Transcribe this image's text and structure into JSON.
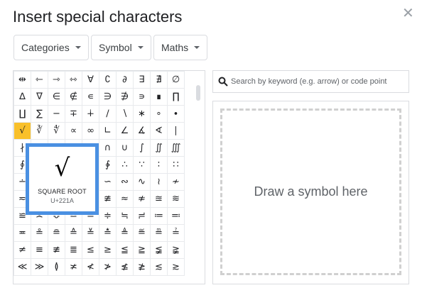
{
  "dialog": {
    "title": "Insert special characters",
    "close_icon": "close-icon"
  },
  "dropdowns": [
    {
      "label": "Categories"
    },
    {
      "label": "Symbol"
    },
    {
      "label": "Maths"
    }
  ],
  "grid": {
    "selected_char": "√",
    "rows": [
      [
        "⇹",
        "⇽",
        "⇾",
        "⇿",
        "∀",
        "∁",
        "∂",
        "∃",
        "∄",
        "∅"
      ],
      [
        "∆",
        "∇",
        "∈",
        "∉",
        "∊",
        "∋",
        "∌",
        "∍",
        "∎",
        "∏"
      ],
      [
        "∐",
        "∑",
        "−",
        "∓",
        "∔",
        "∕",
        "∖",
        "∗",
        "∘",
        "∙"
      ],
      [
        "√",
        "∛",
        "∜",
        "∝",
        "∞",
        "∟",
        "∠",
        "∡",
        "∢",
        "∣"
      ],
      [
        "∤",
        "∥",
        "∦",
        "∧",
        "∨",
        "∩",
        "∪",
        "∫",
        "∬",
        "∭"
      ],
      [
        "∮",
        "∯",
        "∰",
        "∱",
        "∲",
        "∳",
        "∴",
        "∵",
        "∶",
        "∷"
      ],
      [
        "∸",
        "∹",
        "∺",
        "∻",
        "∼",
        "∽",
        "∾",
        "∿",
        "≀",
        "≁"
      ],
      [
        "≂",
        "≃",
        "≄",
        "≅",
        "≆",
        "≇",
        "≈",
        "≉",
        "≊",
        "≋"
      ],
      [
        "≌",
        "≍",
        "≎",
        "≏",
        "≐",
        "≑",
        "≒",
        "≓",
        "≔",
        "≕"
      ],
      [
        "≖",
        "≗",
        "≘",
        "≙",
        "≚",
        "≛",
        "≜",
        "≝",
        "≞",
        "≟"
      ],
      [
        "≠",
        "≡",
        "≢",
        "≣",
        "≤",
        "≥",
        "≦",
        "≧",
        "≨",
        "≩"
      ],
      [
        "≪",
        "≫",
        "≬",
        "≭",
        "≮",
        "≯",
        "≰",
        "≱",
        "≲",
        "≳"
      ]
    ]
  },
  "preview": {
    "glyph": "√",
    "name": "SQUARE ROOT",
    "code": "U+221A"
  },
  "search": {
    "placeholder": "Search by keyword (e.g. arrow) or code point",
    "value": "",
    "icon": "search-icon"
  },
  "draw": {
    "label": "Draw a symbol here"
  },
  "colors": {
    "selection": "#f9c02a",
    "preview_border": "#4a90e2"
  }
}
